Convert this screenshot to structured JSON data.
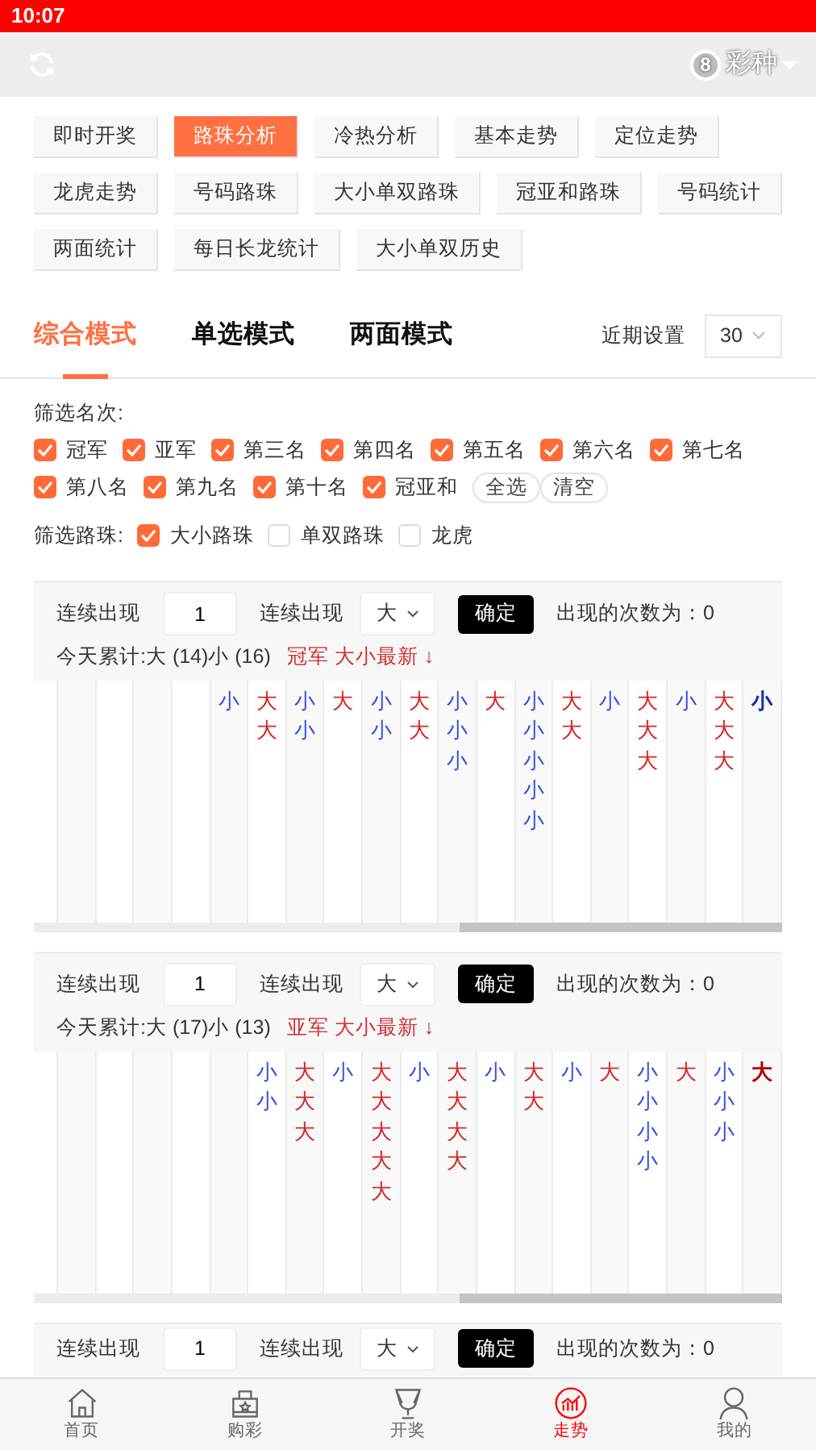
{
  "status_bar": {
    "time": "10:07"
  },
  "top_bar": {
    "ball": "8",
    "lottery_label": "彩种"
  },
  "menu_rows": [
    [
      {
        "label": "即时开奖",
        "selected": false
      },
      {
        "label": "路珠分析",
        "selected": true
      },
      {
        "label": "冷热分析",
        "selected": false
      },
      {
        "label": "基本走势",
        "selected": false
      },
      {
        "label": "定位走势",
        "selected": false
      }
    ],
    [
      {
        "label": "龙虎走势",
        "selected": false
      },
      {
        "label": "号码路珠",
        "selected": false
      },
      {
        "label": "大小单双路珠",
        "selected": false
      },
      {
        "label": "冠亚和路珠",
        "selected": false
      },
      {
        "label": "号码统计",
        "selected": false
      }
    ],
    [
      {
        "label": "两面统计",
        "selected": false
      },
      {
        "label": "每日长龙统计",
        "selected": false
      },
      {
        "label": "大小单双历史",
        "selected": false
      }
    ]
  ],
  "mode_tabs": [
    {
      "label": "综合模式",
      "selected": true
    },
    {
      "label": "单选模式",
      "selected": false
    },
    {
      "label": "两面模式",
      "selected": false
    }
  ],
  "period": {
    "label": "近期设置",
    "value": "30"
  },
  "rank_filter": {
    "label": "筛选名次:",
    "option_rows": [
      [
        {
          "label": "冠军",
          "checked": true
        },
        {
          "label": "亚军",
          "checked": true
        },
        {
          "label": "第三名",
          "checked": true
        },
        {
          "label": "第四名",
          "checked": true
        },
        {
          "label": "第五名",
          "checked": true
        },
        {
          "label": "第六名",
          "checked": true
        },
        {
          "label": "第七名",
          "checked": true
        }
      ],
      [
        {
          "label": "第八名",
          "checked": true
        },
        {
          "label": "第九名",
          "checked": true
        },
        {
          "label": "第十名",
          "checked": true
        },
        {
          "label": "冠亚和",
          "checked": true
        }
      ]
    ],
    "actions": [
      "全选",
      "清空"
    ]
  },
  "road_filter": {
    "label": "筛选路珠:",
    "options": [
      {
        "label": "大小路珠",
        "checked": true
      },
      {
        "label": "单双路珠",
        "checked": false
      },
      {
        "label": "龙虎",
        "checked": false
      }
    ]
  },
  "panels": [
    {
      "streak_label": "连续出现",
      "count": "1",
      "streak_label_2": "连续出现",
      "type": "大",
      "confirm": "确定",
      "result": "出现的次数为：0",
      "summary": "今天累计:大 (14)小 (16)",
      "latest_title": "冠军 大小最新 ↓",
      "columns": [
        {
          "kind": "empty"
        },
        {
          "kind": "empty"
        },
        {
          "kind": "empty"
        },
        {
          "kind": "empty"
        },
        {
          "kind": "empty"
        },
        {
          "kind": "small",
          "marks": [
            "小"
          ]
        },
        {
          "kind": "big",
          "marks": [
            "大",
            "大"
          ]
        },
        {
          "kind": "small",
          "marks": [
            "小",
            "小"
          ]
        },
        {
          "kind": "big",
          "marks": [
            "大"
          ]
        },
        {
          "kind": "small",
          "marks": [
            "小",
            "小"
          ]
        },
        {
          "kind": "big",
          "marks": [
            "大",
            "大"
          ]
        },
        {
          "kind": "small",
          "marks": [
            "小",
            "小",
            "小"
          ]
        },
        {
          "kind": "big",
          "marks": [
            "大"
          ]
        },
        {
          "kind": "small",
          "marks": [
            "小",
            "小",
            "小",
            "小",
            "小"
          ]
        },
        {
          "kind": "big",
          "marks": [
            "大",
            "大"
          ]
        },
        {
          "kind": "small",
          "marks": [
            "小"
          ]
        },
        {
          "kind": "big",
          "marks": [
            "大",
            "大",
            "大"
          ]
        },
        {
          "kind": "small",
          "marks": [
            "小"
          ]
        },
        {
          "kind": "big",
          "marks": [
            "大",
            "大",
            "大"
          ]
        },
        {
          "kind": "small",
          "marks": [
            "小"
          ],
          "latest": true
        }
      ]
    },
    {
      "streak_label": "连续出现",
      "count": "1",
      "streak_label_2": "连续出现",
      "type": "大",
      "confirm": "确定",
      "result": "出现的次数为：0",
      "summary": "今天累计:大 (17)小 (13)",
      "latest_title": "亚军 大小最新 ↓",
      "columns": [
        {
          "kind": "empty"
        },
        {
          "kind": "empty"
        },
        {
          "kind": "empty"
        },
        {
          "kind": "empty"
        },
        {
          "kind": "empty"
        },
        {
          "kind": "empty"
        },
        {
          "kind": "small",
          "marks": [
            "小",
            "小"
          ]
        },
        {
          "kind": "big",
          "marks": [
            "大",
            "大",
            "大"
          ]
        },
        {
          "kind": "small",
          "marks": [
            "小"
          ]
        },
        {
          "kind": "big",
          "marks": [
            "大",
            "大",
            "大",
            "大",
            "大"
          ]
        },
        {
          "kind": "small",
          "marks": [
            "小"
          ]
        },
        {
          "kind": "big",
          "marks": [
            "大",
            "大",
            "大",
            "大"
          ]
        },
        {
          "kind": "small",
          "marks": [
            "小"
          ]
        },
        {
          "kind": "big",
          "marks": [
            "大",
            "大"
          ]
        },
        {
          "kind": "small",
          "marks": [
            "小"
          ]
        },
        {
          "kind": "big",
          "marks": [
            "大"
          ]
        },
        {
          "kind": "small",
          "marks": [
            "小",
            "小",
            "小",
            "小"
          ]
        },
        {
          "kind": "big",
          "marks": [
            "大"
          ]
        },
        {
          "kind": "small",
          "marks": [
            "小",
            "小",
            "小"
          ]
        },
        {
          "kind": "big",
          "marks": [
            "大"
          ],
          "latest": true
        }
      ]
    },
    {
      "streak_label": "连续出现",
      "count": "1",
      "streak_label_2": "连续出现",
      "type": "大",
      "confirm": "确定",
      "result": "出现的次数为：0"
    }
  ],
  "bottom_nav": [
    {
      "kind": "home",
      "label": "首页",
      "selected": false
    },
    {
      "kind": "bag",
      "label": "购彩",
      "selected": false
    },
    {
      "kind": "trophy",
      "label": "开奖",
      "selected": false
    },
    {
      "kind": "trend",
      "label": "走势",
      "selected": true
    },
    {
      "kind": "person",
      "label": "我的",
      "selected": false
    }
  ]
}
